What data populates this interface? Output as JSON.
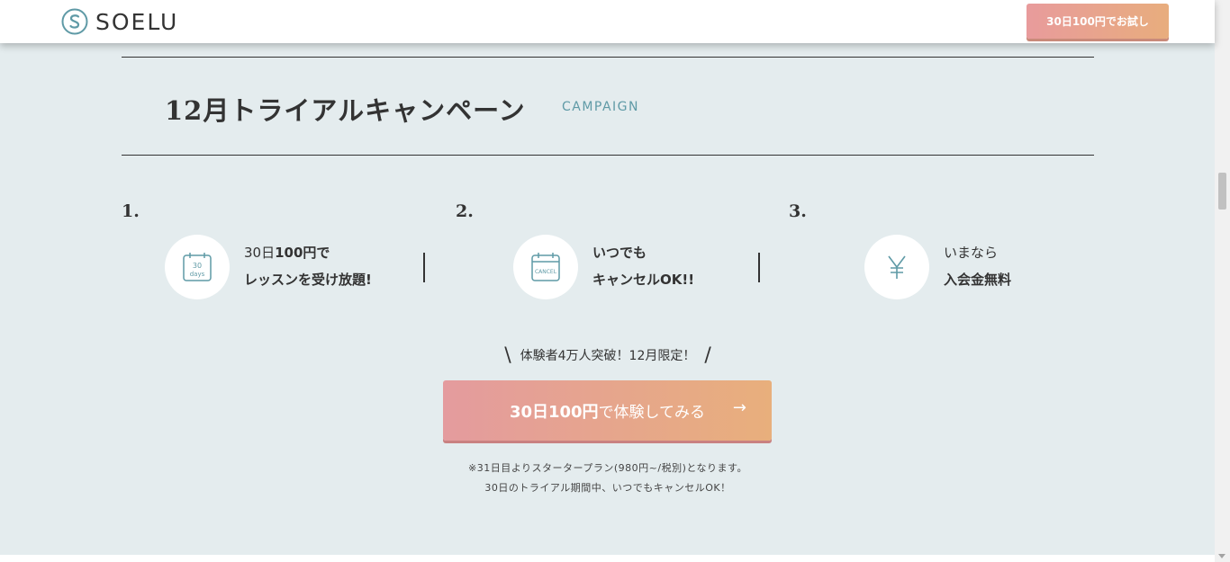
{
  "header": {
    "logo_text": "SOELU",
    "cta_label": "30日100円でお試し"
  },
  "section": {
    "title": "12月トライアルキャンペーン",
    "subtitle": "CAMPAIGN"
  },
  "features": [
    {
      "number": "1.",
      "icon": "calendar-30-days-icon",
      "icon_text_top": "30",
      "icon_text_bottom": "days",
      "line1_plain": "30日",
      "line1_bold": "100円で",
      "line2": "レッスンを受け放題!"
    },
    {
      "number": "2.",
      "icon": "calendar-cancel-icon",
      "icon_text": "CANCEL",
      "line1": "いつでも",
      "line2": "キャンセルOK!!"
    },
    {
      "number": "3.",
      "icon": "yen-icon",
      "line1": "いまなら",
      "line2": "入会金無料"
    }
  ],
  "promo": {
    "text": "体験者4万人突破！12月限定！",
    "slash_left": "\\",
    "slash_right": "/"
  },
  "main_cta": {
    "label_bold": "30日100円",
    "label_rest": "で体験してみる",
    "arrow": "→"
  },
  "notes": {
    "line1": "※31日目よりスタータープラン(980円~/税別)となります。",
    "line2": "30日のトライアル期間中、いつでもキャンセルOK！"
  },
  "colors": {
    "background": "#e4ecee",
    "accent_teal": "#5f9aa6",
    "cta_gradient_start": "#e49b9e",
    "cta_gradient_end": "#e8af7c"
  }
}
